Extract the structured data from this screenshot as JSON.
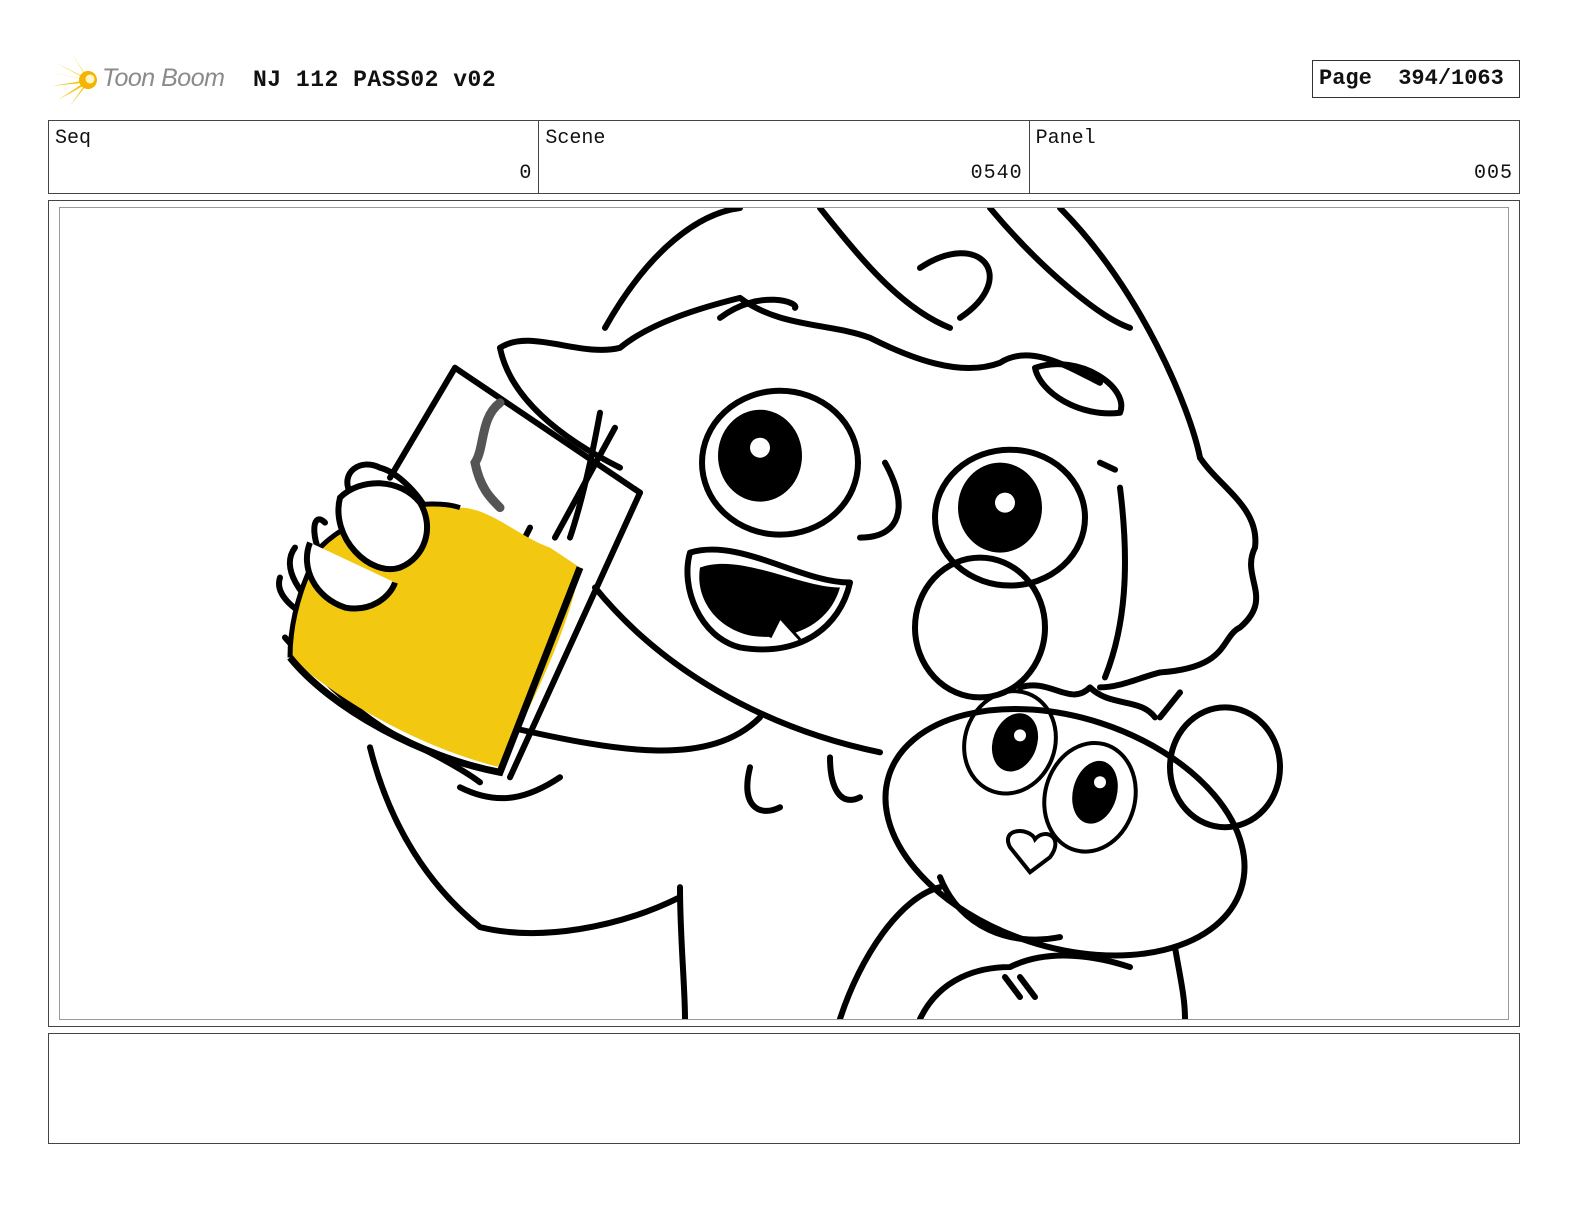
{
  "header": {
    "logo_text": "Toon Boom",
    "project_title": "NJ 112 PASS02 v02",
    "page_label": "Page",
    "page_number": "394/1063"
  },
  "info": {
    "seq": {
      "label": "Seq",
      "value": "0"
    },
    "scene": {
      "label": "Scene",
      "value": "0540"
    },
    "panel": {
      "label": "Panel",
      "value": "005"
    }
  },
  "notes": {
    "text": ""
  },
  "colors": {
    "accent_yellow": "#f2c811",
    "ink": "#000000",
    "logo_gray": "#8a8a8a"
  },
  "icons": {
    "logo": "toon-boom-spark-icon"
  }
}
